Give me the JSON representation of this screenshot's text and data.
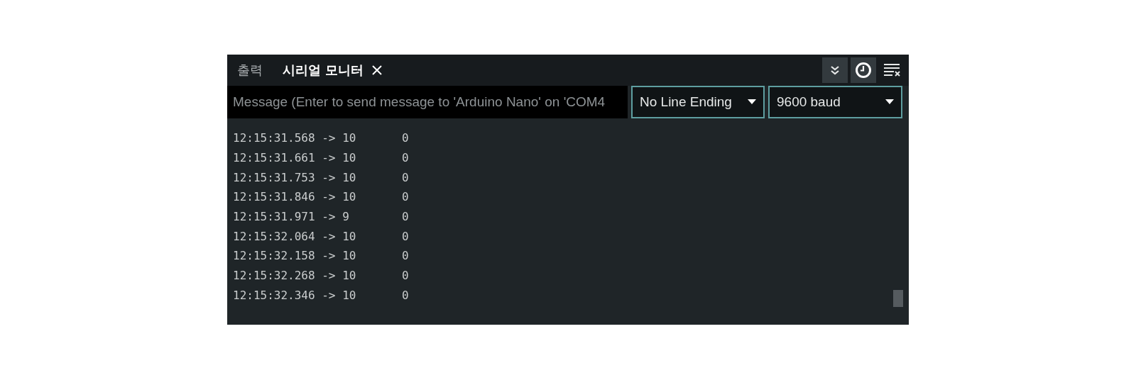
{
  "tabs": [
    {
      "label": "출력",
      "selected": false,
      "closable": false
    },
    {
      "label": "시리얼 모니터",
      "selected": true,
      "closable": true
    }
  ],
  "toolbar": [
    {
      "kind": "autoscroll",
      "on": true
    },
    {
      "kind": "timestamp",
      "on": true
    },
    {
      "kind": "clear",
      "on": false
    }
  ],
  "message_field": {
    "placeholder": "Message (Enter to send message to 'Arduino Nano' on 'COM4"
  },
  "line_ending": {
    "value": "No Line Ending"
  },
  "baud_rate": {
    "value": "9600 baud"
  },
  "output": [
    {
      "text": "12:15:31.568 -> 10",
      "value": "0"
    },
    {
      "text": "12:15:31.661 -> 10",
      "value": "0"
    },
    {
      "text": "12:15:31.753 -> 10",
      "value": "0"
    },
    {
      "text": "12:15:31.846 -> 10",
      "value": "0"
    },
    {
      "text": "12:15:31.971 -> 9",
      "value": "0"
    },
    {
      "text": "12:15:32.064 -> 10",
      "value": "0"
    },
    {
      "text": "12:15:32.158 -> 10",
      "value": "0"
    },
    {
      "text": "12:15:32.268 -> 10",
      "value": "0"
    },
    {
      "text": "12:15:32.346 -> 10",
      "value": "0"
    }
  ]
}
